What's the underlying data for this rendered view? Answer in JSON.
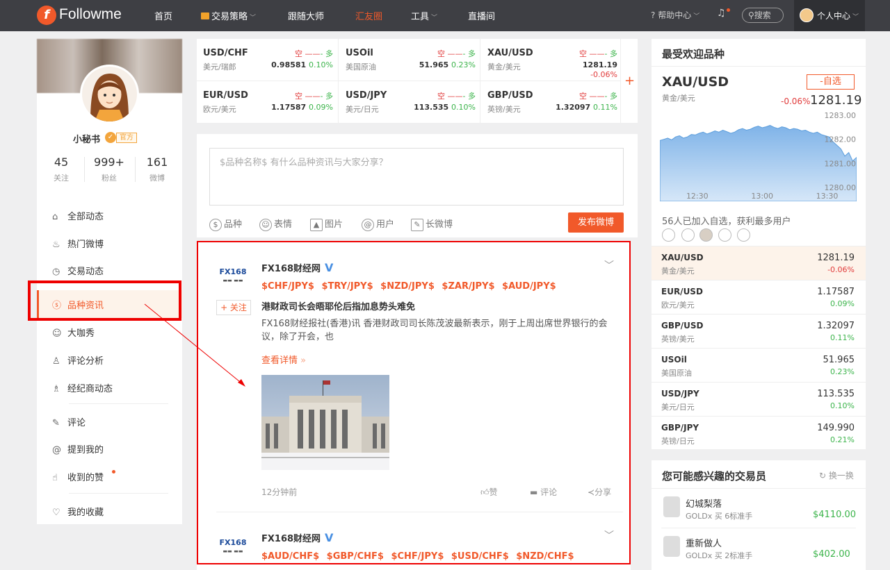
{
  "nav": {
    "brand": "Followme",
    "items": [
      {
        "label": "首页"
      },
      {
        "label": "交易策略"
      },
      {
        "label": "跟随大师"
      },
      {
        "label": "汇友圈"
      },
      {
        "label": "工具"
      },
      {
        "label": "直播间"
      }
    ],
    "help": "帮助中心",
    "search": "搜索",
    "user_center": "个人中心"
  },
  "profile": {
    "name": "小秘书",
    "official_badge": "官方",
    "stats": [
      {
        "value": "45",
        "label": "关注"
      },
      {
        "value": "999+",
        "label": "粉丝"
      },
      {
        "value": "161",
        "label": "微博"
      }
    ]
  },
  "menu": {
    "items": [
      {
        "label": "全部动态",
        "icon": "house-icon"
      },
      {
        "label": "热门微博",
        "icon": "fire-icon"
      },
      {
        "label": "交易动态",
        "icon": "clock-icon"
      },
      {
        "label": "品种资讯",
        "icon": "dollar-icon"
      },
      {
        "label": "大咖秀",
        "icon": "star-user-icon"
      },
      {
        "label": "评论分析",
        "icon": "analyst-icon"
      },
      {
        "label": "经纪商动态",
        "icon": "person-icon"
      },
      {
        "label": "评论",
        "icon": "pen-icon"
      },
      {
        "label": "提到我的",
        "icon": "at-icon"
      },
      {
        "label": "收到的赞",
        "icon": "thumb-icon"
      },
      {
        "label": "我的收藏",
        "icon": "heart-icon"
      }
    ],
    "active_index": 3
  },
  "ticker": {
    "short_label": "空",
    "long_label": "多",
    "items": [
      {
        "symbol": "USD/CHF",
        "cn": "美元/瑞郎",
        "price": "0.98581",
        "change": "0.10%"
      },
      {
        "symbol": "USOil",
        "cn": "美国原油",
        "price": "51.965",
        "change": "0.23%"
      },
      {
        "symbol": "XAU/USD",
        "cn": "黄金/美元",
        "price": "1281.19",
        "change": "-0.06%"
      },
      {
        "symbol": "EUR/USD",
        "cn": "欧元/美元",
        "price": "1.17587",
        "change": "0.09%"
      },
      {
        "symbol": "USD/JPY",
        "cn": "美元/日元",
        "price": "113.535",
        "change": "0.10%"
      },
      {
        "symbol": "GBP/USD",
        "cn": "英镑/美元",
        "price": "1.32097",
        "change": "0.11%"
      }
    ],
    "add_label": "+"
  },
  "composer": {
    "placeholder": "$品种名称$ 有什么品种资讯与大家分享？",
    "tools": [
      {
        "label": "品种",
        "icon": "dollar-icon"
      },
      {
        "label": "表情",
        "icon": "smile-icon"
      },
      {
        "label": "图片",
        "icon": "image-icon"
      },
      {
        "label": "用户",
        "icon": "at-icon"
      },
      {
        "label": "长微博",
        "icon": "edit-icon"
      }
    ],
    "publish": "发布微博"
  },
  "posts": [
    {
      "logo": "FX168",
      "author": "FX168财经网",
      "verified": "V",
      "follow": "+ 关注",
      "tags": "$CHF/JPY$ $TRY/JPY$ $NZD/JPY$ $ZAR/JPY$ $AUD/JPY$",
      "title": "港财政司长会晤耶伦后指加息势头难免",
      "body": "FX168财经报社(香港)讯 香港财政司司长陈茂波最新表示，刚于上周出席世界银行的会议，除了开会，也",
      "more": "查看详情",
      "time": "12分钟前",
      "like": "赞",
      "comment": "评论",
      "share": "分享"
    },
    {
      "logo": "FX168",
      "author": "FX168财经网",
      "verified": "V",
      "tags": "$AUD/CHF$ $GBP/CHF$ $CHF/JPY$ $USD/CHF$ $NZD/CHF$"
    }
  ],
  "popular": {
    "title": "最受欢迎品种",
    "featured": {
      "symbol": "XAU/USD",
      "cn": "黄金/美元",
      "add": "-自选",
      "change": "-0.06%",
      "price": "1281.19"
    },
    "chart_data": {
      "type": "area",
      "x_ticks": [
        "12:30",
        "13:00",
        "13:30"
      ],
      "y_ticks": [
        "1283.00",
        "1282.00",
        "1281.00",
        "1280.00"
      ],
      "ylim": [
        1280.0,
        1283.0
      ],
      "values": [
        1281.95,
        1282.0,
        1282.05,
        1281.98,
        1282.1,
        1282.15,
        1282.05,
        1282.1,
        1282.2,
        1282.18,
        1282.25,
        1282.3,
        1282.22,
        1282.28,
        1282.35,
        1282.3,
        1282.38,
        1282.32,
        1282.25,
        1282.3,
        1282.4,
        1282.45,
        1282.38,
        1282.42,
        1282.5,
        1282.55,
        1282.48,
        1282.52,
        1282.58,
        1282.5,
        1282.45,
        1282.52,
        1282.48,
        1282.4,
        1282.45,
        1282.42,
        1282.35,
        1282.38,
        1282.3,
        1282.25,
        1282.3,
        1282.2,
        1282.15,
        1282.1,
        1281.9,
        1281.75,
        1281.6,
        1281.3,
        1281.45,
        1281.1,
        1281.25
      ]
    },
    "joined": "56人已加入自选，获利最多用户",
    "watchlist": [
      {
        "symbol": "XAU/USD",
        "cn": "黄金/美元",
        "price": "1281.19",
        "change": "-0.06%"
      },
      {
        "symbol": "EUR/USD",
        "cn": "欧元/美元",
        "price": "1.17587",
        "change": "0.09%"
      },
      {
        "symbol": "GBP/USD",
        "cn": "英镑/美元",
        "price": "1.32097",
        "change": "0.11%"
      },
      {
        "symbol": "USOil",
        "cn": "美国原油",
        "price": "51.965",
        "change": "0.23%"
      },
      {
        "symbol": "USD/JPY",
        "cn": "美元/日元",
        "price": "113.535",
        "change": "0.10%"
      },
      {
        "symbol": "GBP/JPY",
        "cn": "英镑/日元",
        "price": "149.990",
        "change": "0.21%"
      }
    ]
  },
  "traders": {
    "title": "您可能感兴趣的交易员",
    "refresh": "换一换",
    "items": [
      {
        "name": "幻城梨落",
        "sub": "GOLDx  买  6标准手",
        "value": "$4110.00"
      },
      {
        "name": "重新做人",
        "sub": "GOLDx  买  2标准手",
        "value": "$402.00"
      }
    ]
  },
  "colors": {
    "brand": "#f1592a",
    "nav_bg": "#3e3f44",
    "up": "#3cb44b",
    "down": "#e13b3b",
    "highlight": "#e00000"
  }
}
